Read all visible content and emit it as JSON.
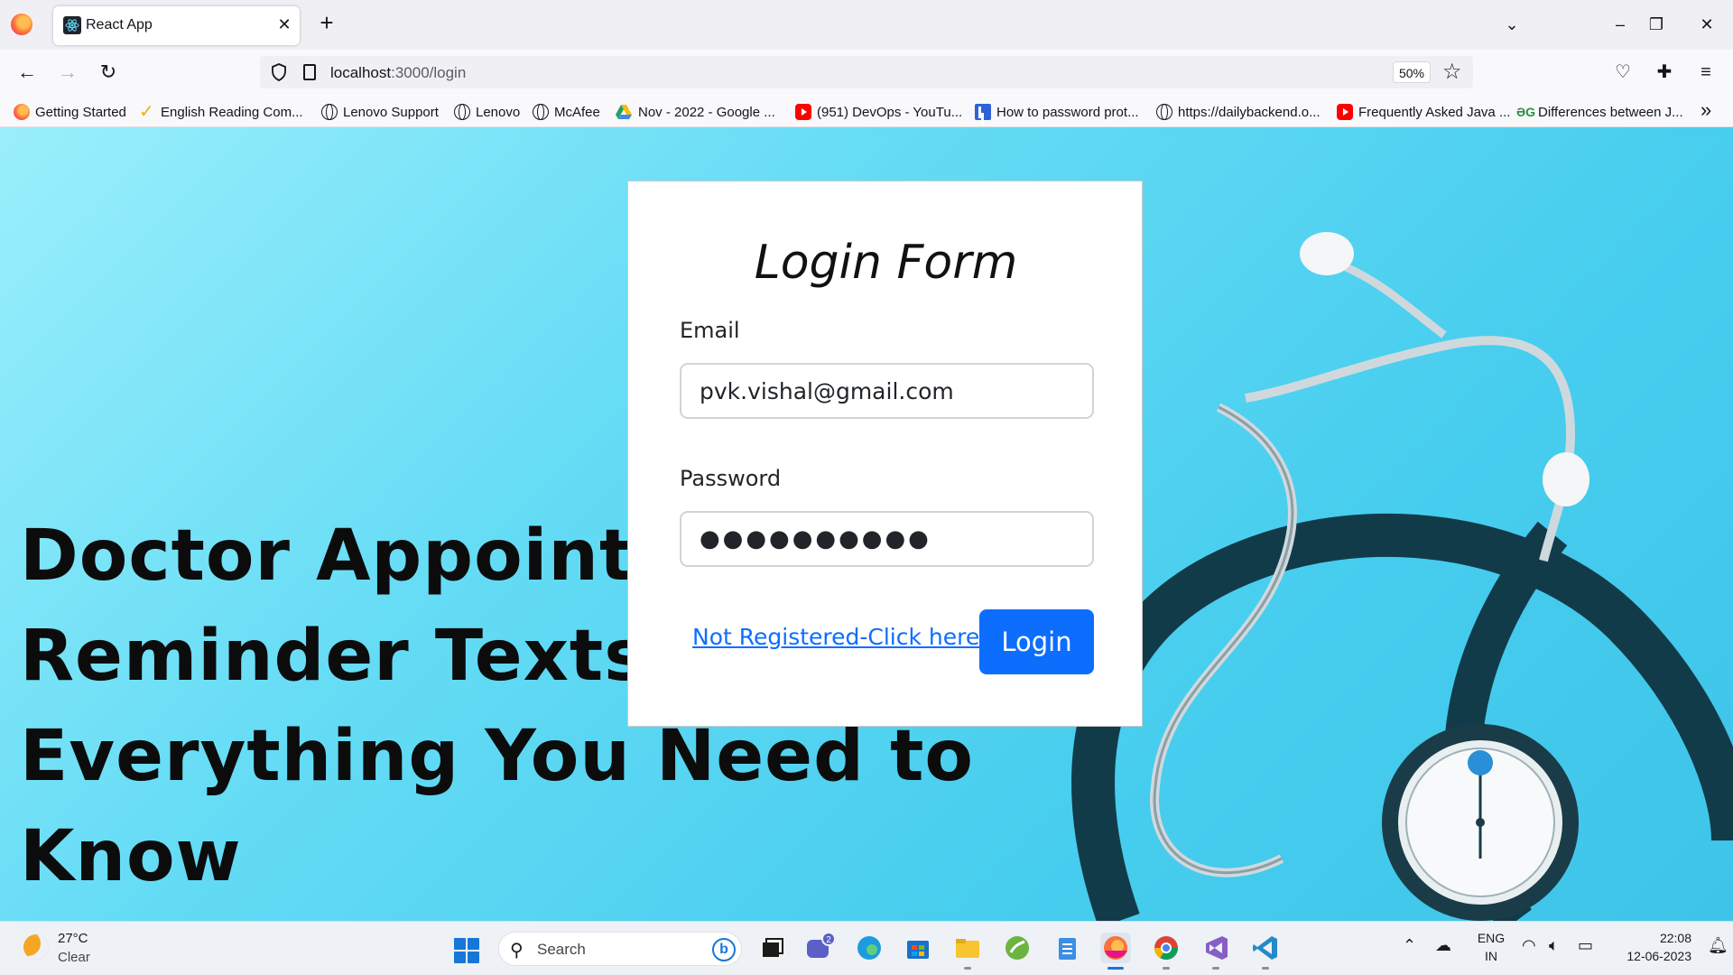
{
  "browser": {
    "tab_title": "React App",
    "tab_close_icon": "close-icon",
    "url_host": "localhost",
    "url_path": ":3000/login",
    "zoom": "50%"
  },
  "bookmarks": [
    {
      "label": "Getting Started",
      "icon": "firefox"
    },
    {
      "label": "English Reading Com...",
      "icon": "check"
    },
    {
      "label": "Lenovo Support",
      "icon": "globe"
    },
    {
      "label": "Lenovo",
      "icon": "globe"
    },
    {
      "label": "McAfee",
      "icon": "globe"
    },
    {
      "label": "Nov - 2022 - Google ...",
      "icon": "drive"
    },
    {
      "label": "(951) DevOps - YouTu...",
      "icon": "youtube"
    },
    {
      "label": "How to password prot...",
      "icon": "lbox"
    },
    {
      "label": "https://dailybackend.o...",
      "icon": "globe"
    },
    {
      "label": "Frequently Asked Java ...",
      "icon": "youtube"
    },
    {
      "label": "Differences between J...",
      "icon": "gfg"
    }
  ],
  "background": {
    "heading_lines": [
      "Doctor Appointment",
      "Reminder Texts:",
      "Everything You Need to",
      "Know"
    ]
  },
  "login": {
    "title": "Login Form",
    "email_label": "Email",
    "email_value": "pvk.vishal@gmail.com",
    "password_label": "Password",
    "password_value": "●●●●●●●●●●",
    "register_link": "Not Registered-Click here",
    "login_button": "Login"
  },
  "taskbar": {
    "weather_temp": "27°C",
    "weather_condition": "Clear",
    "search_placeholder": "Search",
    "chat_badge": "2",
    "language": "ENG",
    "region": "IN",
    "time": "22:08",
    "date": "12-06-2023"
  }
}
